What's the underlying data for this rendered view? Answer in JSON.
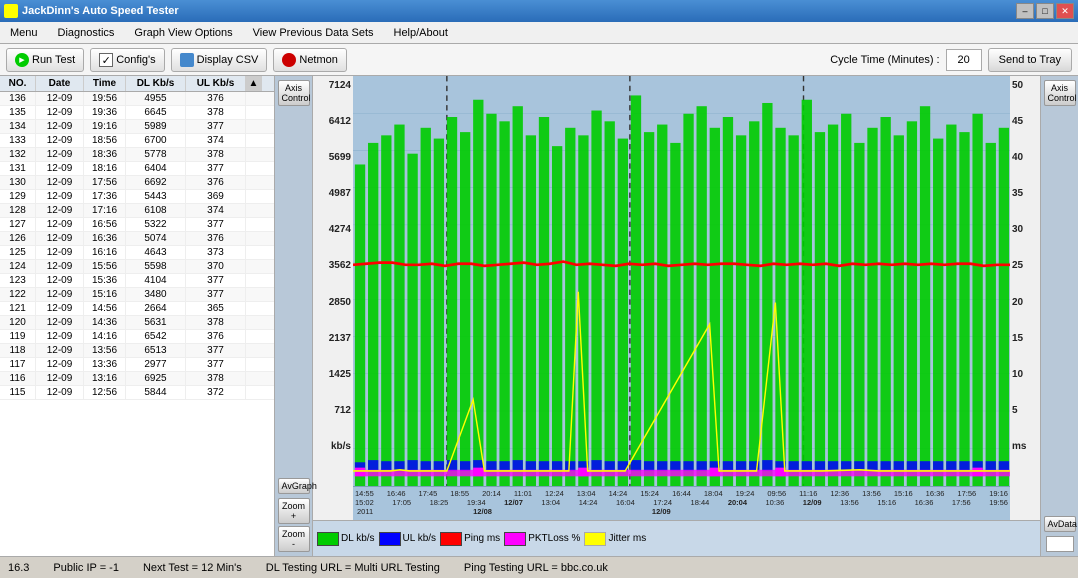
{
  "titlebar": {
    "title": "JackDinn's Auto Speed Tester",
    "controls": [
      "–",
      "□",
      "✕"
    ]
  },
  "menubar": {
    "items": [
      "Menu",
      "Diagnostics",
      "Graph View Options",
      "View Previous Data Sets",
      "Help/About"
    ]
  },
  "toolbar": {
    "run_test_label": "Run Test",
    "configs_label": "Config's",
    "display_csv_label": "Display CSV",
    "netmon_label": "Netmon",
    "cycle_time_label": "Cycle Time (Minutes) :",
    "cycle_time_value": "20",
    "send_tray_label": "Send to Tray"
  },
  "table": {
    "headers": [
      "NO.",
      "Date",
      "Time",
      "DL Kb/s",
      "UL Kb/s"
    ],
    "rows": [
      [
        "136",
        "12-09",
        "19:56",
        "4955",
        "376"
      ],
      [
        "135",
        "12-09",
        "19:36",
        "6645",
        "378"
      ],
      [
        "134",
        "12-09",
        "19:16",
        "5989",
        "377"
      ],
      [
        "133",
        "12-09",
        "18:56",
        "6700",
        "374"
      ],
      [
        "132",
        "12-09",
        "18:36",
        "5778",
        "378"
      ],
      [
        "131",
        "12-09",
        "18:16",
        "6404",
        "377"
      ],
      [
        "130",
        "12-09",
        "17:56",
        "6692",
        "376"
      ],
      [
        "129",
        "12-09",
        "17:36",
        "5443",
        "369"
      ],
      [
        "128",
        "12-09",
        "17:16",
        "6108",
        "374"
      ],
      [
        "127",
        "12-09",
        "16:56",
        "5322",
        "377"
      ],
      [
        "126",
        "12-09",
        "16:36",
        "5074",
        "376"
      ],
      [
        "125",
        "12-09",
        "16:16",
        "4643",
        "373"
      ],
      [
        "124",
        "12-09",
        "15:56",
        "5598",
        "370"
      ],
      [
        "123",
        "12-09",
        "15:36",
        "4104",
        "377"
      ],
      [
        "122",
        "12-09",
        "15:16",
        "3480",
        "377"
      ],
      [
        "121",
        "12-09",
        "14:56",
        "2664",
        "365"
      ],
      [
        "120",
        "12-09",
        "14:36",
        "5631",
        "378"
      ],
      [
        "119",
        "12-09",
        "14:16",
        "6542",
        "376"
      ],
      [
        "118",
        "12-09",
        "13:56",
        "6513",
        "377"
      ],
      [
        "117",
        "12-09",
        "13:36",
        "2977",
        "377"
      ],
      [
        "116",
        "12-09",
        "13:16",
        "6925",
        "378"
      ],
      [
        "115",
        "12-09",
        "12:56",
        "5844",
        "372"
      ]
    ]
  },
  "graph": {
    "y_axis_left": [
      "7124",
      "6412",
      "5699",
      "4987",
      "4274",
      "3562",
      "2850",
      "2137",
      "1425",
      "712",
      "kb/s"
    ],
    "y_axis_right": [
      "50",
      "45",
      "40",
      "35",
      "30",
      "25",
      "20",
      "15",
      "10",
      "5",
      "ms"
    ],
    "x_axis_top": [
      "14:55",
      "16:46",
      "17:45",
      "18:55",
      "20:14",
      "11:01",
      "12:24",
      "13:04",
      "14:24",
      "15:24",
      "16:44",
      "18:04",
      "19:24",
      "09:56",
      "11:16",
      "12:36",
      "13:56",
      "15:16",
      "16:36",
      "17:56",
      "19:16"
    ],
    "x_axis_dates": [
      "15:02",
      "17:05",
      "18:25",
      "19:34",
      "12/07",
      "12:24",
      "13:04",
      "14:24",
      "16:04",
      "17:24",
      "18:44",
      "20:04",
      "12/09",
      "10:36",
      "12:36",
      "13:56",
      "15:16",
      "16:36",
      "17:56",
      "19:56"
    ],
    "date_labels": [
      "12/07",
      "2011",
      "",
      "12/08",
      "",
      "12/09"
    ],
    "axis_ctrl_left_label": "Axis\nControl",
    "axis_ctrl_right_label": "Axis\nControl",
    "av_graph_label": "AvGraph",
    "zoom_in_label": "Zoom +",
    "zoom_out_label": "Zoom -",
    "av_data_label": "AvData"
  },
  "legend": {
    "items": [
      {
        "label": "DL kb/s",
        "color": "#00cc00"
      },
      {
        "label": "UL kb/s",
        "color": "#0000ff"
      },
      {
        "label": "Ping ms",
        "color": "#ff0000"
      },
      {
        "label": "PKTLoss %",
        "color": "#ff00ff"
      },
      {
        "label": "Jitter ms",
        "color": "#ffff00"
      }
    ]
  },
  "statusbar": {
    "version": "16.3",
    "public_ip": "Public IP = -1",
    "next_test": "Next Test = 12 Min's",
    "dl_url": "DL Testing URL = Multi URL Testing",
    "ping_url": "Ping Testing URL = bbc.co.uk"
  }
}
